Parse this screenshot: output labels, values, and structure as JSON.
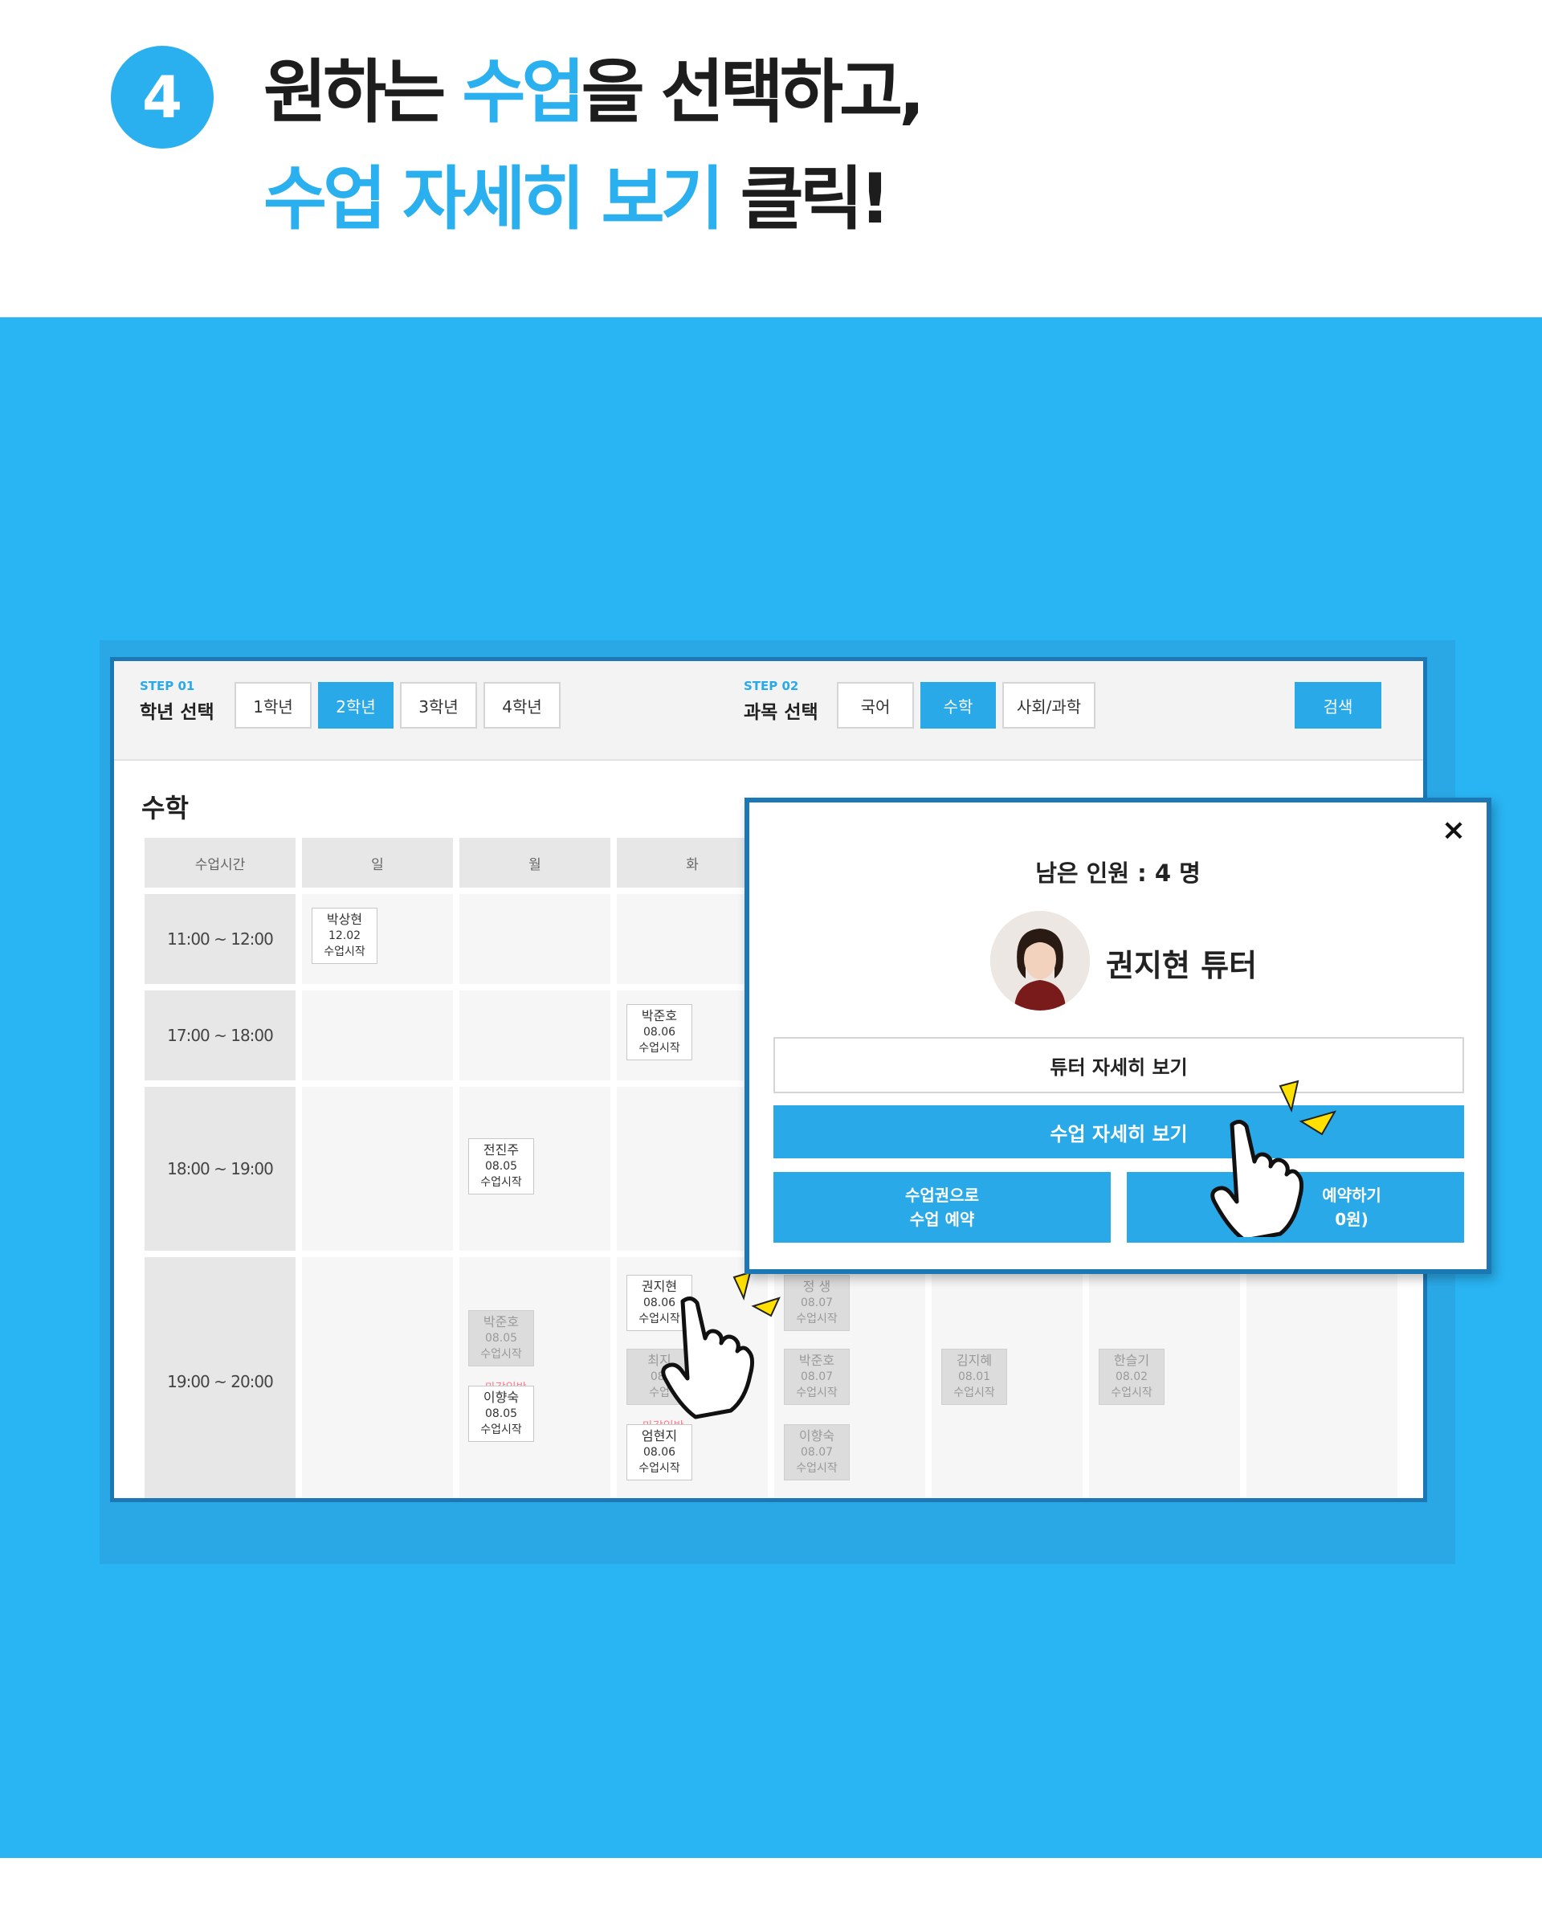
{
  "header": {
    "step_number": "4",
    "line1": [
      {
        "text": "원하는 ",
        "highlight": false
      },
      {
        "text": "수업",
        "highlight": true
      },
      {
        "text": "을 선택하고,",
        "highlight": false
      }
    ],
    "line2": [
      {
        "text": "수업 자세히 보기",
        "highlight": true
      },
      {
        "text": " 클릭!",
        "highlight": false
      }
    ]
  },
  "colors": {
    "accent": "#2bb0ef",
    "background": "#29b4f3",
    "frame_border": "#1c78b5",
    "deadline": "#ff7b8e"
  },
  "filter": {
    "step1_label": "STEP 01",
    "step1_title": "학년 선택",
    "grades": [
      "1학년",
      "2학년",
      "3학년",
      "4학년"
    ],
    "selected_grade": "2학년",
    "step2_label": "STEP 02",
    "step2_title": "과목 선택",
    "subjects": [
      "국어",
      "수학",
      "사회/과학"
    ],
    "selected_subject": "수학",
    "search_label": "검색"
  },
  "schedule": {
    "title": "수학",
    "time_header": "수업시간",
    "days": [
      "일",
      "월",
      "화"
    ],
    "times": [
      "11:00 ~ 12:00",
      "17:00 ~ 18:00",
      "18:00 ~ 19:00",
      "19:00 ~ 20:00"
    ],
    "classes": [
      {
        "name": "박상현",
        "date": "12.02",
        "status": "수업시작",
        "dim": false
      },
      {
        "name": "박준호",
        "date": "08.06",
        "status": "수업시작",
        "dim": false
      },
      {
        "name": "전진주",
        "date": "08.05",
        "status": "수업시작",
        "dim": false
      },
      {
        "name": "박준호",
        "date": "08.05",
        "status": "수업시작",
        "dim": true
      },
      {
        "name": "이향숙",
        "date": "08.05",
        "status": "수업시작",
        "dim": false
      },
      {
        "name": "권지현",
        "date": "08.06",
        "status": "수업시작",
        "dim": false
      },
      {
        "name": "최지",
        "date": "08.",
        "status": "수업",
        "dim": true
      },
      {
        "name": "엄현지",
        "date": "08.06",
        "status": "수업시작",
        "dim": false
      },
      {
        "name": "정 생",
        "date": "08.07",
        "status": "수업시작",
        "dim": true
      },
      {
        "name": "박준호",
        "date": "08.07",
        "status": "수업시작",
        "dim": true
      },
      {
        "name": "이향숙",
        "date": "08.07",
        "status": "수업시작",
        "dim": true
      },
      {
        "name": "김지혜",
        "date": "08.01",
        "status": "수업시작",
        "dim": true
      },
      {
        "name": "한슬기",
        "date": "08.02",
        "status": "수업시작",
        "dim": true
      }
    ],
    "deadline_label": "마감임박"
  },
  "modal": {
    "close_label": "×",
    "remaining_text": "남은 인원 : 4 명",
    "tutor_name": "권지현 튜터",
    "tutor_detail_label": "튜터 자세히 보기",
    "class_detail_label": "수업 자세히 보기",
    "ticket_label_line1": "수업권으로",
    "ticket_label_line2": "수업 예약",
    "pay_label_line1": "예약하기",
    "pay_label_line2": "0원)"
  }
}
